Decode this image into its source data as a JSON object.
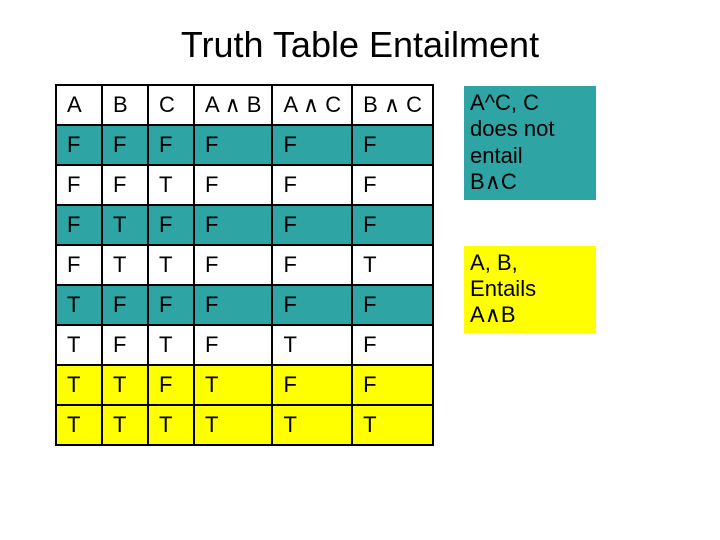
{
  "title": "Truth Table Entailment",
  "headers": {
    "c0": "A",
    "c1": "B",
    "c2": "C",
    "c3": "A ∧ B",
    "c4": "A ∧ C",
    "c5": "B ∧ C"
  },
  "rows": [
    {
      "c0": "F",
      "c1": "F",
      "c2": "F",
      "c3": "F",
      "c4": "F",
      "c5": "F",
      "color": "teal"
    },
    {
      "c0": "F",
      "c1": "F",
      "c2": "T",
      "c3": "F",
      "c4": "F",
      "c5": "F",
      "color": "white"
    },
    {
      "c0": "F",
      "c1": "T",
      "c2": "F",
      "c3": "F",
      "c4": "F",
      "c5": "F",
      "color": "teal"
    },
    {
      "c0": "F",
      "c1": "T",
      "c2": "T",
      "c3": "F",
      "c4": "F",
      "c5": "T",
      "color": "white"
    },
    {
      "c0": "T",
      "c1": "F",
      "c2": "F",
      "c3": "F",
      "c4": "F",
      "c5": "F",
      "color": "teal"
    },
    {
      "c0": "T",
      "c1": "F",
      "c2": "T",
      "c3": "F",
      "c4": "T",
      "c5": "F",
      "color": "white"
    },
    {
      "c0": "T",
      "c1": "T",
      "c2": "F",
      "c3": "T",
      "c4": "F",
      "c5": "F",
      "color": "yellow"
    },
    {
      "c0": "T",
      "c1": "T",
      "c2": "T",
      "c3": "T",
      "c4": "T",
      "c5": "T",
      "color": "yellow"
    }
  ],
  "note1": {
    "l0": "A^C, C",
    "l1": "does not",
    "l2": "entail",
    "l3": "B∧C"
  },
  "note2": {
    "l0": "A, B,",
    "l1": "Entails",
    "l2": "A∧B"
  }
}
